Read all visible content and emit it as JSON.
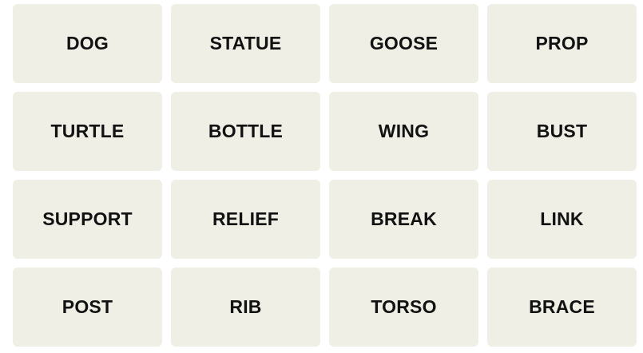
{
  "tiles": [
    {
      "label": "DOG"
    },
    {
      "label": "STATUE"
    },
    {
      "label": "GOOSE"
    },
    {
      "label": "PROP"
    },
    {
      "label": "TURTLE"
    },
    {
      "label": "BOTTLE"
    },
    {
      "label": "WING"
    },
    {
      "label": "BUST"
    },
    {
      "label": "SUPPORT"
    },
    {
      "label": "RELIEF"
    },
    {
      "label": "BREAK"
    },
    {
      "label": "LINK"
    },
    {
      "label": "POST"
    },
    {
      "label": "RIB"
    },
    {
      "label": "TORSO"
    },
    {
      "label": "BRACE"
    }
  ],
  "colors": {
    "tile_background": "#efefe6",
    "tile_text": "#121212",
    "page_background": "#ffffff"
  }
}
